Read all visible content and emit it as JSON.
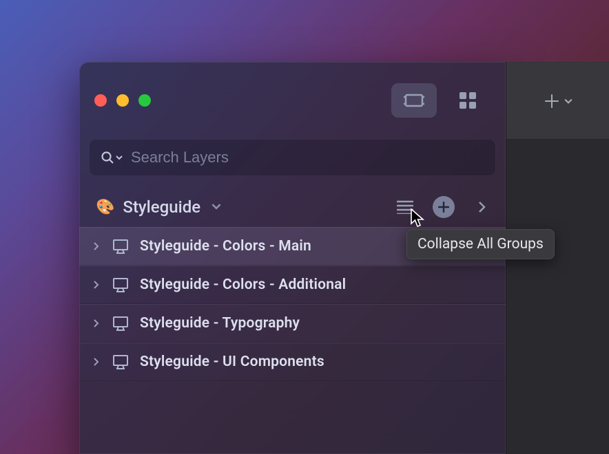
{
  "window": {
    "traffic": {
      "close": "close",
      "minimize": "minimize",
      "zoom": "zoom"
    }
  },
  "toolbar_right": {
    "add_label": "+"
  },
  "search": {
    "placeholder": "Search Layers",
    "value": ""
  },
  "section": {
    "icon": "🎨",
    "title": "Styleguide",
    "actions": {
      "collapse_tooltip": "Collapse All Groups"
    }
  },
  "layers": [
    {
      "label": "Styleguide - Colors - Main",
      "selected": true
    },
    {
      "label": "Styleguide - Colors - Additional",
      "selected": false
    },
    {
      "label": "Styleguide - Typography",
      "selected": false
    },
    {
      "label": "Styleguide - UI Components",
      "selected": false
    }
  ],
  "colors": {
    "accent": "#7a8099"
  }
}
